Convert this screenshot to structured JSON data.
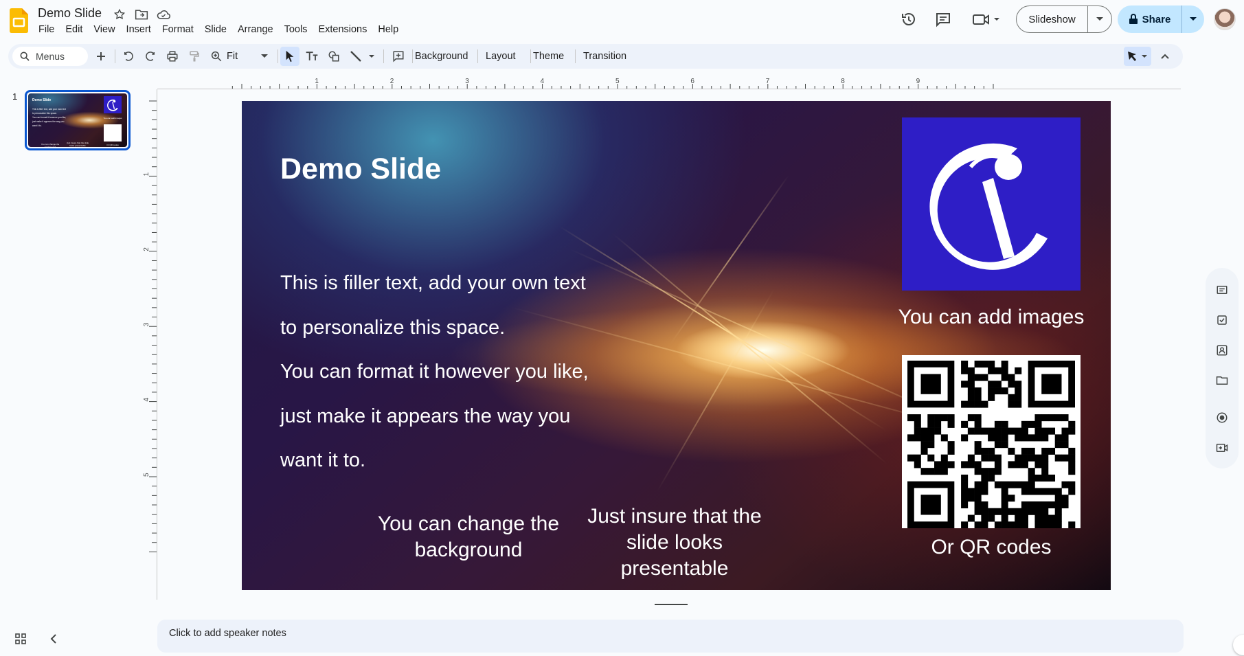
{
  "app": {
    "document_title": "Demo Slide",
    "brand_color": "#fbbc04",
    "accent_color": "#0b57d0"
  },
  "menu": [
    "File",
    "Edit",
    "View",
    "Insert",
    "Format",
    "Slide",
    "Arrange",
    "Tools",
    "Extensions",
    "Help"
  ],
  "header": {
    "slideshow_label": "Slideshow",
    "share_label": "Share",
    "icons": [
      "history-icon",
      "comments-icon",
      "meet-icon",
      "avatar"
    ]
  },
  "toolbar": {
    "search_placeholder": "Menus",
    "zoom_value": "Fit",
    "background_label": "Background",
    "layout_label": "Layout",
    "theme_label": "Theme",
    "transition_label": "Transition"
  },
  "filmstrip": {
    "slide_number": "1"
  },
  "ruler": {
    "horizontal_ticks": [
      "1",
      "2",
      "3",
      "4",
      "5",
      "6",
      "7",
      "8",
      "9"
    ],
    "vertical_ticks": [
      "1",
      "2",
      "3",
      "4",
      "5"
    ]
  },
  "slide": {
    "title": "Demo Slide",
    "body_lines": [
      "This is filler text, add your own text",
      "to personalize this space.",
      "You can format it however you like,",
      "just make it appears the way you",
      "want it to."
    ],
    "caption_background_1": "You can change the",
    "caption_background_2": "background",
    "caption_presentable_1": "Just insure that the",
    "caption_presentable_2": "slide looks",
    "caption_presentable_3": "presentable",
    "caption_images": "You can add images",
    "caption_qr": "Or QR codes",
    "logo_color": "#2e1ec6"
  },
  "notes": {
    "placeholder": "Click to add speaker notes"
  }
}
